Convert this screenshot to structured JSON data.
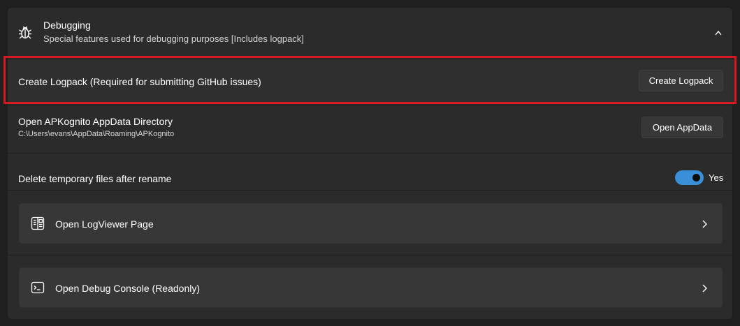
{
  "section": {
    "title": "Debugging",
    "subtitle": "Special features used for debugging purposes [Includes logpack]",
    "icon": "bug-icon",
    "expanded": true
  },
  "logpack": {
    "label": "Create Logpack (Required for submitting GitHub issues)",
    "button_label": "Create Logpack",
    "highlight_color": "#d71921"
  },
  "appdata": {
    "label": "Open APKognito AppData Directory",
    "path": "C:\\Users\\evans\\AppData\\Roaming\\APKognito",
    "button_label": "Open AppData"
  },
  "tempfiles": {
    "label": "Delete temporary files after rename",
    "toggle_on": true,
    "toggle_state_label": "Yes",
    "accent": "#3a8fd9"
  },
  "cards": [
    {
      "label": "Open LogViewer Page",
      "icon": "log-viewer-icon"
    },
    {
      "label": "Open Debug Console (Readonly)",
      "icon": "console-icon"
    }
  ]
}
